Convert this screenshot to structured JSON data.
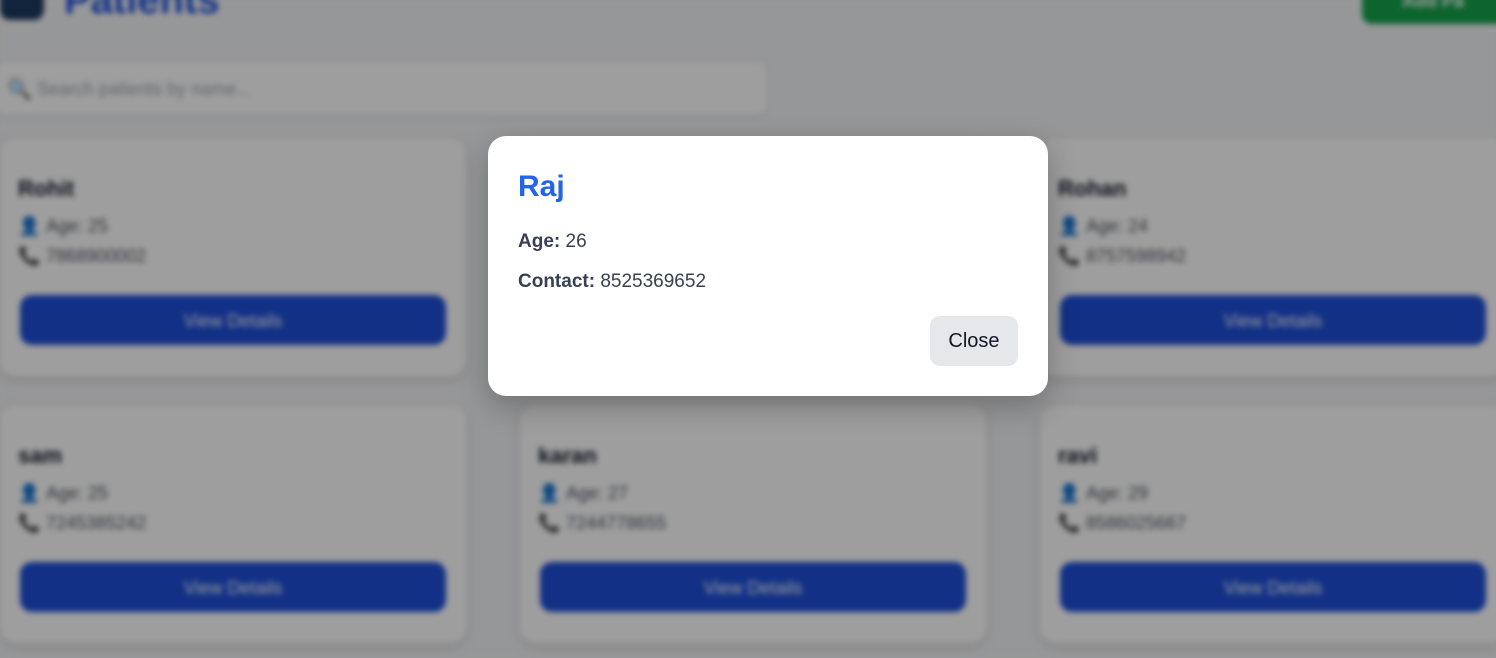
{
  "header": {
    "title": "Patients",
    "add_button_label": "Add Pa"
  },
  "search": {
    "placeholder": "Search patients by name..."
  },
  "patients": [
    {
      "name": "Rohit",
      "age": "Age: 25",
      "phone": "7868900002",
      "button": "View Details"
    },
    {
      "name": "Rohan",
      "age": "Age: 24",
      "phone": "8757598942",
      "button": "View Details"
    },
    {
      "name": "sam",
      "age": "Age: 25",
      "phone": "7245385242",
      "button": "View Details"
    },
    {
      "name": "karan",
      "age": "Age: 27",
      "phone": "7244778655",
      "button": "View Details"
    },
    {
      "name": "ravi",
      "age": "Age: 29",
      "phone": "8586025667",
      "button": "View Details"
    }
  ],
  "modal": {
    "title": "Raj",
    "age_label": "Age:",
    "age_value": "26",
    "contact_label": "Contact:",
    "contact_value": "8525369652",
    "close_label": "Close"
  },
  "icons": {
    "person": "person-icon",
    "phone": "phone-icon",
    "search": "search-icon"
  },
  "colors": {
    "primary": "#1d4ed8",
    "title_blue": "#2563eb",
    "success": "#16a34a",
    "close_bg": "#e5e7eb"
  }
}
